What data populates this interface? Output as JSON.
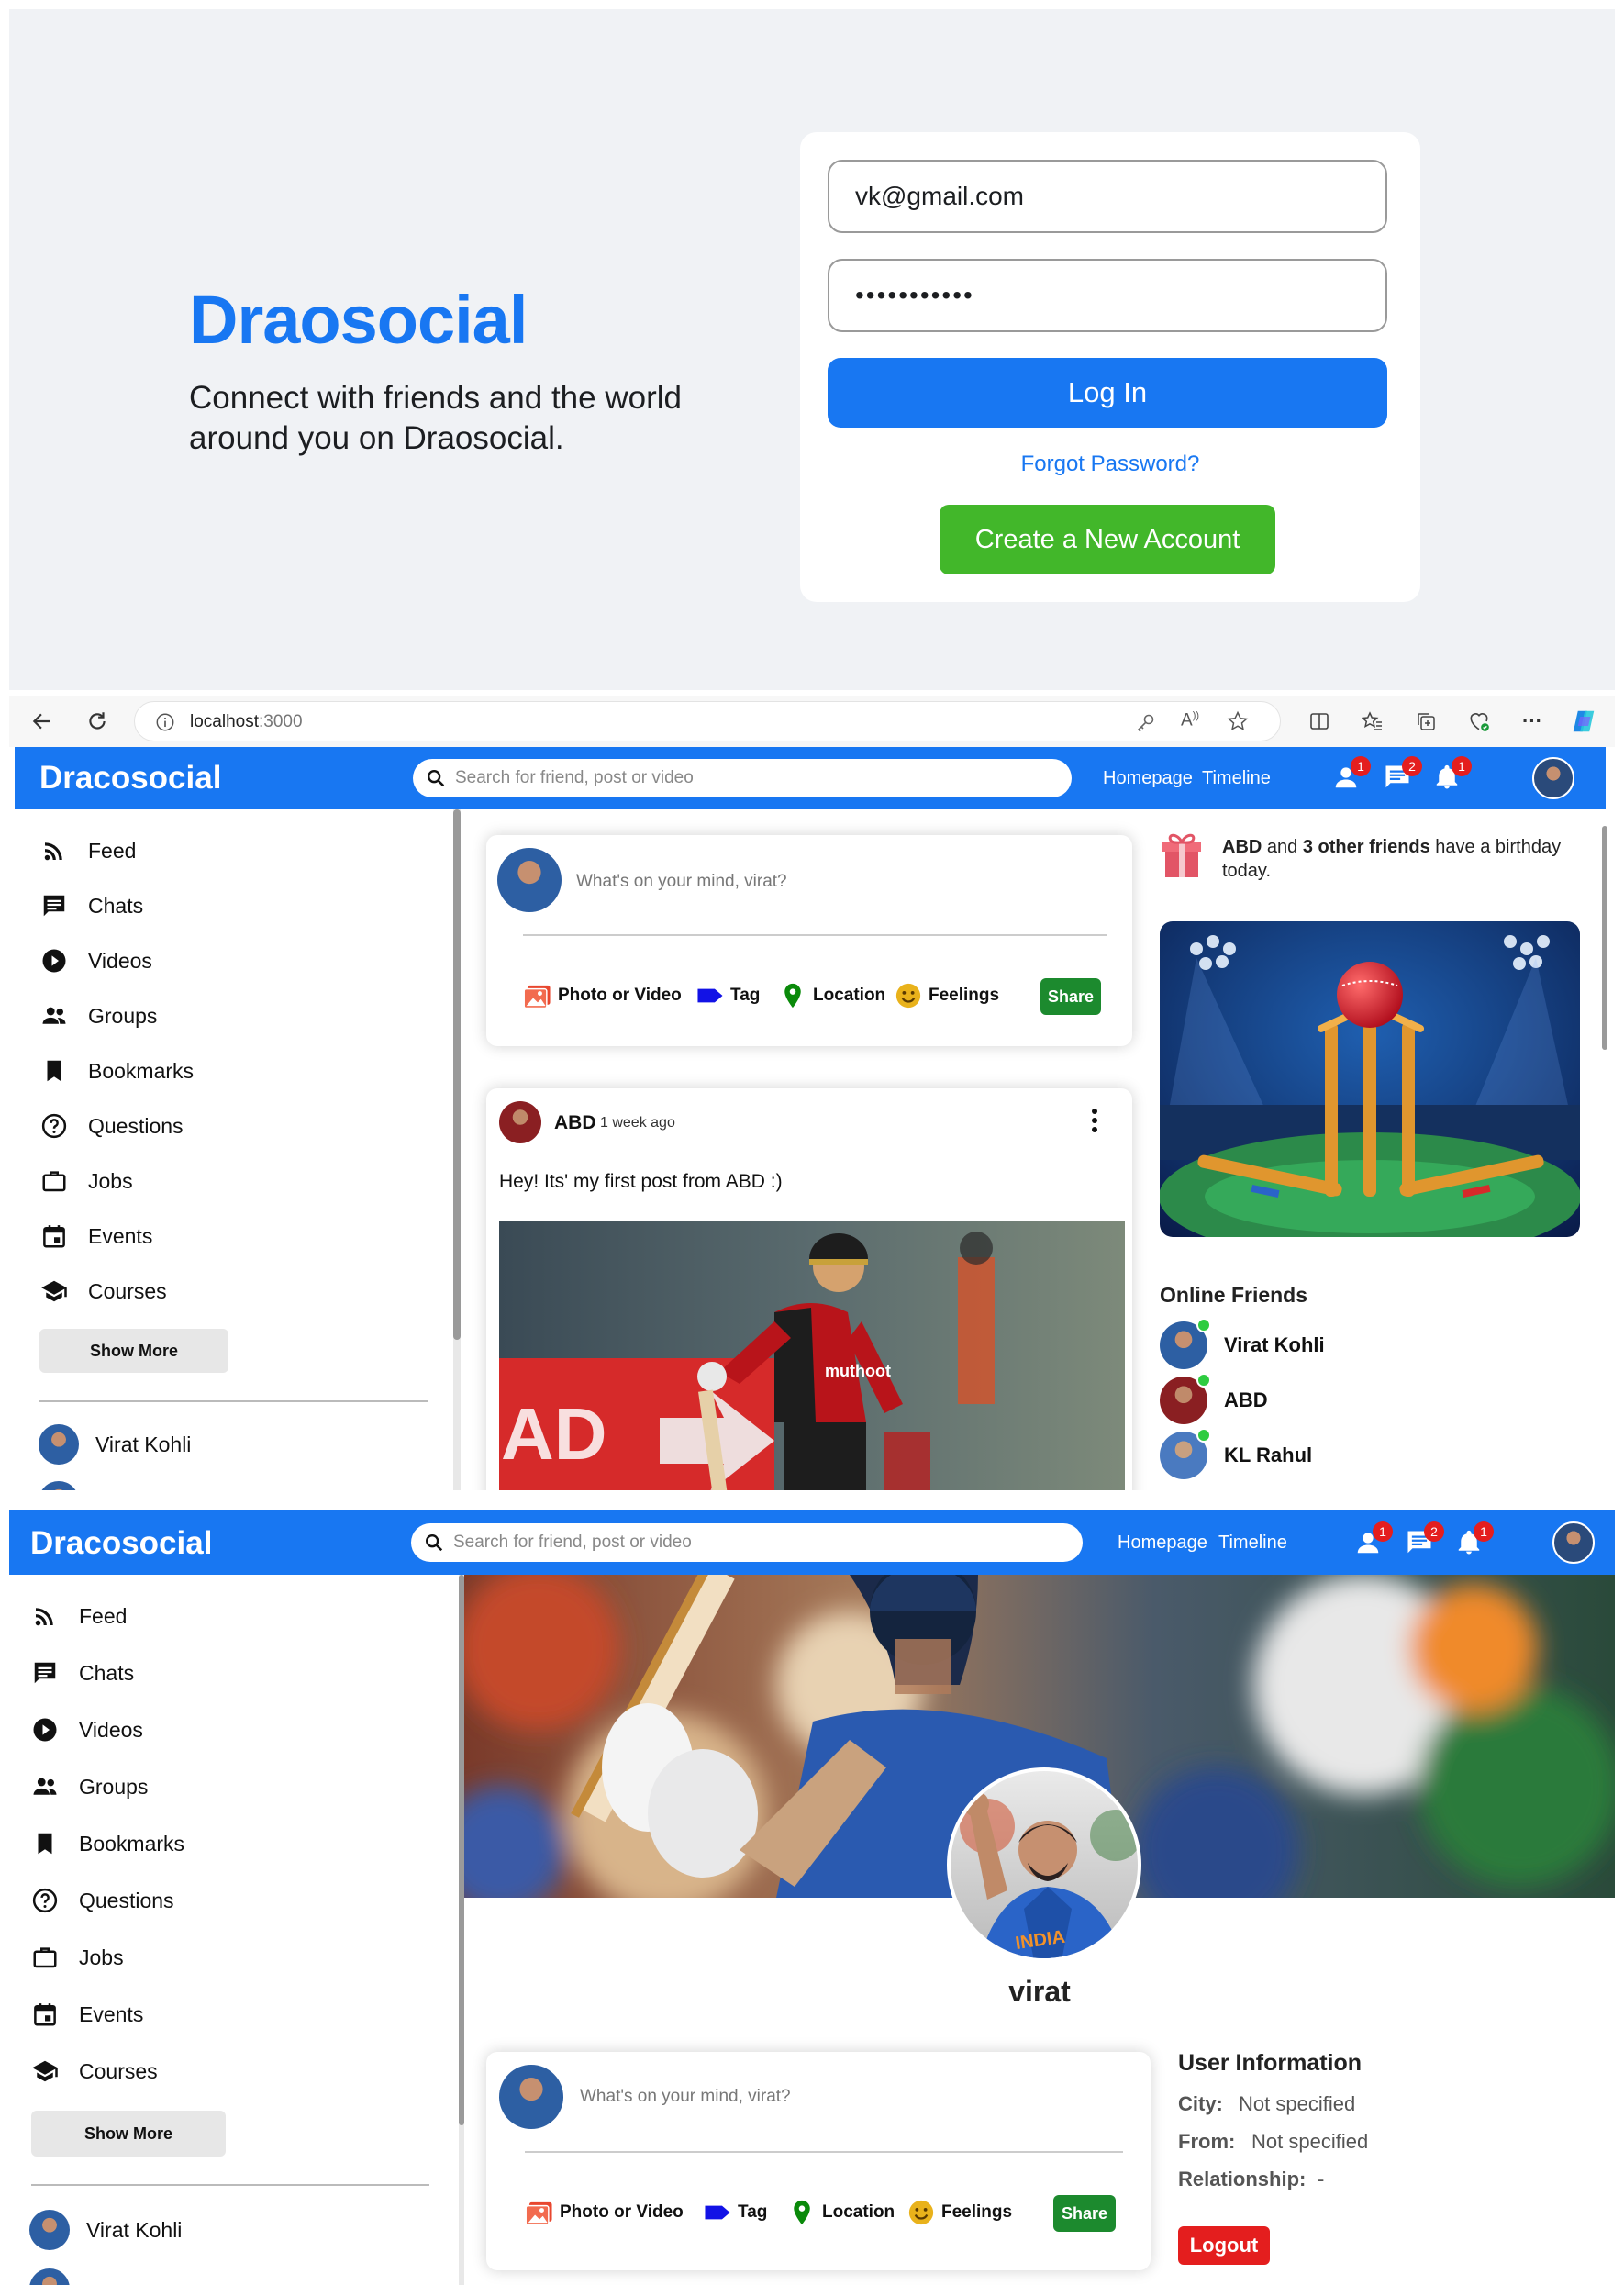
{
  "login": {
    "brand": "Draosocial",
    "description": "Connect with friends and the world around you on Draosocial.",
    "email_value": "vk@gmail.com",
    "password_mask": "•••••••••••",
    "login_label": "Log In",
    "forgot_label": "Forgot Password?",
    "create_label": "Create a New Account"
  },
  "browser": {
    "host": "localhost",
    "port": ":3000"
  },
  "topbar": {
    "logo": "Dracosocial",
    "search_placeholder": "Search for friend, post or video",
    "links": [
      "Homepage",
      "Timeline"
    ],
    "badges": {
      "person": "1",
      "chat": "2",
      "notifications": "1"
    }
  },
  "sidebar": {
    "items": [
      {
        "label": "Feed",
        "icon": "rss-feed-icon"
      },
      {
        "label": "Chats",
        "icon": "chat-icon"
      },
      {
        "label": "Videos",
        "icon": "play-circle-icon"
      },
      {
        "label": "Groups",
        "icon": "group-icon"
      },
      {
        "label": "Bookmarks",
        "icon": "bookmark-icon"
      },
      {
        "label": "Questions",
        "icon": "help-circle-icon"
      },
      {
        "label": "Jobs",
        "icon": "work-icon"
      },
      {
        "label": "Events",
        "icon": "event-icon"
      },
      {
        "label": "Courses",
        "icon": "school-icon"
      }
    ],
    "show_more": "Show More",
    "friends": [
      "Virat Kohli"
    ]
  },
  "share": {
    "placeholder": "What's on your mind, virat?",
    "options": [
      "Photo or Video",
      "Tag",
      "Location",
      "Feelings"
    ],
    "button": "Share",
    "colors": {
      "photo": "#e8472f",
      "tag": "#1212e6",
      "location": "#0a8a0a",
      "feelings": "#e9b21b",
      "share": "#1c8a2e"
    }
  },
  "post": {
    "username": "ABD",
    "date": "1 week ago",
    "text": "Hey! Its' my first post from ABD :)",
    "jersey_text": "muthoot"
  },
  "rightbar": {
    "birthday_name": "ABD",
    "birthday_mid": " and ",
    "birthday_others": "3 other friends",
    "birthday_tail": " have a birthday today.",
    "online_title": "Online Friends",
    "online": [
      "Virat Kohli",
      "ABD",
      "KL Rahul"
    ]
  },
  "profile": {
    "username": "virat",
    "info_title": "User Information",
    "info": [
      {
        "label": "City:",
        "value": "Not specified"
      },
      {
        "label": "From:",
        "value": "Not specified"
      },
      {
        "label": "Relationship:",
        "value": "-"
      }
    ],
    "logout": "Logout"
  }
}
